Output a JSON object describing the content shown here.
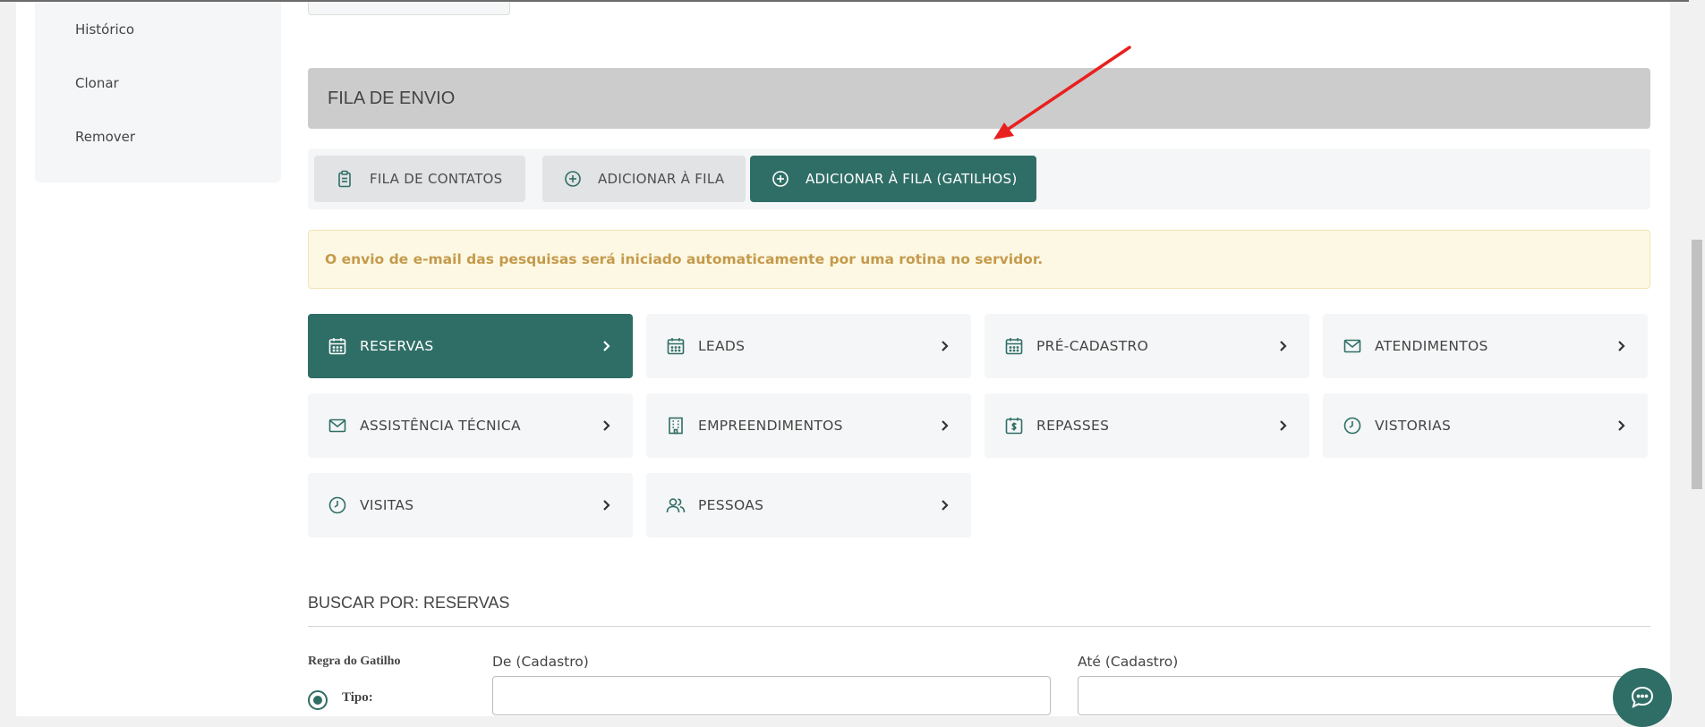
{
  "sidebar": {
    "items": [
      {
        "label": "Histórico"
      },
      {
        "label": "Clonar"
      },
      {
        "label": "Remover"
      }
    ]
  },
  "section": {
    "title": "FILA DE ENVIO"
  },
  "tabs": [
    {
      "label": "FILA DE CONTATOS",
      "icon": "clipboard-icon",
      "active": false
    },
    {
      "label": "ADICIONAR À FILA",
      "icon": "plus-circle-icon",
      "active": false
    },
    {
      "label": "ADICIONAR À FILA (GATILHOS)",
      "icon": "plus-circle-icon",
      "active": true
    }
  ],
  "alert": {
    "text": "O envio de e-mail das pesquisas será iniciado automaticamente por uma rotina no servidor."
  },
  "categories": [
    {
      "label": "RESERVAS",
      "icon": "calendar-icon",
      "active": true
    },
    {
      "label": "LEADS",
      "icon": "calendar-icon",
      "active": false
    },
    {
      "label": "PRÉ-CADASTRO",
      "icon": "calendar-icon",
      "active": false
    },
    {
      "label": "ATENDIMENTOS",
      "icon": "envelope-icon",
      "active": false
    },
    {
      "label": "ASSISTÊNCIA TÉCNICA",
      "icon": "envelope-icon",
      "active": false
    },
    {
      "label": "EMPREENDIMENTOS",
      "icon": "building-icon",
      "active": false
    },
    {
      "label": "REPASSES",
      "icon": "calendar-money-icon",
      "active": false
    },
    {
      "label": "VISTORIAS",
      "icon": "clock-icon",
      "active": false
    },
    {
      "label": "VISITAS",
      "icon": "clock-icon",
      "active": false
    },
    {
      "label": "PESSOAS",
      "icon": "people-icon",
      "active": false
    }
  ],
  "search": {
    "title": "BUSCAR POR: RESERVAS",
    "rule_label": "Regra do Gatilho",
    "type_label": "Tipo:",
    "from_label": "De (Cadastro)",
    "to_label": "Até (Cadastro)",
    "from_value": "",
    "to_value": ""
  },
  "colors": {
    "accent": "#2f6e66",
    "alert_text": "#c59a4c",
    "alert_bg": "#fcf8e3",
    "annotation_arrow": "#e8201f"
  }
}
